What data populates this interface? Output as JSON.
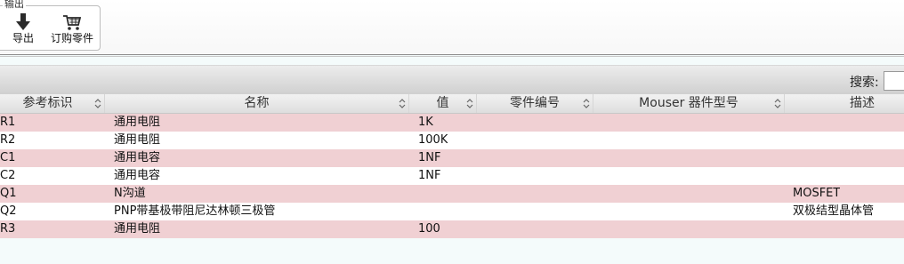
{
  "toolbar": {
    "group_label": "输出",
    "export_label": "导出",
    "order_label": "订购零件"
  },
  "search": {
    "label": "搜索:",
    "value": ""
  },
  "table": {
    "headers": [
      "参考标识",
      "名称",
      "值",
      "零件编号",
      "Mouser 器件型号",
      "描述"
    ],
    "rows": [
      {
        "ref": "R1",
        "name": "通用电阻",
        "value": "1K",
        "part": "",
        "mouser": "",
        "desc": ""
      },
      {
        "ref": "R2",
        "name": "通用电阻",
        "value": "100K",
        "part": "",
        "mouser": "",
        "desc": ""
      },
      {
        "ref": "C1",
        "name": "通用电容",
        "value": "1NF",
        "part": "",
        "mouser": "",
        "desc": ""
      },
      {
        "ref": "C2",
        "name": "通用电容",
        "value": "1NF",
        "part": "",
        "mouser": "",
        "desc": ""
      },
      {
        "ref": "Q1",
        "name": "N沟道",
        "value": "",
        "part": "",
        "mouser": "",
        "desc": "MOSFET"
      },
      {
        "ref": "Q2",
        "name": "PNP带基极带阻尼达林顿三极管",
        "value": "",
        "part": "",
        "mouser": "",
        "desc": "双极结型晶体管"
      },
      {
        "ref": "R3",
        "name": "通用电阻",
        "value": "100",
        "part": "",
        "mouser": "",
        "desc": ""
      }
    ]
  },
  "colors": {
    "row_odd": "#f0d0d3",
    "row_even": "#ffffff"
  }
}
